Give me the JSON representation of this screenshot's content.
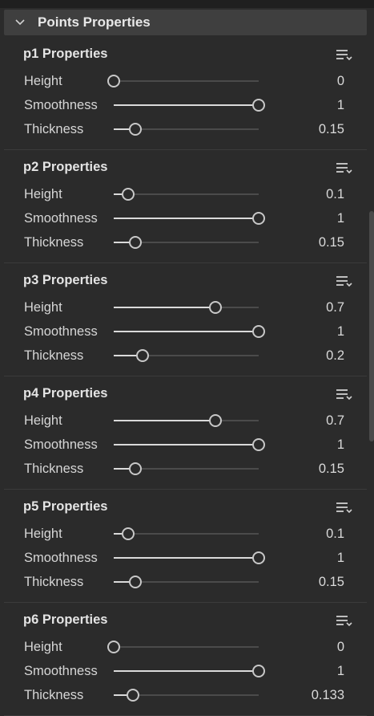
{
  "header": {
    "title": "Points Properties"
  },
  "panels": [
    {
      "title": "p1 Properties",
      "rows": [
        {
          "label": "Height",
          "value": "0",
          "level": 0
        },
        {
          "label": "Smoothness",
          "value": "1",
          "level": 1
        },
        {
          "label": "Thickness",
          "value": "0.15",
          "level": 0.15
        }
      ]
    },
    {
      "title": "p2 Properties",
      "rows": [
        {
          "label": "Height",
          "value": "0.1",
          "level": 0.1
        },
        {
          "label": "Smoothness",
          "value": "1",
          "level": 1
        },
        {
          "label": "Thickness",
          "value": "0.15",
          "level": 0.15
        }
      ]
    },
    {
      "title": "p3 Properties",
      "rows": [
        {
          "label": "Height",
          "value": "0.7",
          "level": 0.7
        },
        {
          "label": "Smoothness",
          "value": "1",
          "level": 1
        },
        {
          "label": "Thickness",
          "value": "0.2",
          "level": 0.2
        }
      ]
    },
    {
      "title": "p4 Properties",
      "rows": [
        {
          "label": "Height",
          "value": "0.7",
          "level": 0.7
        },
        {
          "label": "Smoothness",
          "value": "1",
          "level": 1
        },
        {
          "label": "Thickness",
          "value": "0.15",
          "level": 0.15
        }
      ]
    },
    {
      "title": "p5 Properties",
      "rows": [
        {
          "label": "Height",
          "value": "0.1",
          "level": 0.1
        },
        {
          "label": "Smoothness",
          "value": "1",
          "level": 1
        },
        {
          "label": "Thickness",
          "value": "0.15",
          "level": 0.15
        }
      ]
    },
    {
      "title": "p6 Properties",
      "rows": [
        {
          "label": "Height",
          "value": "0",
          "level": 0
        },
        {
          "label": "Smoothness",
          "value": "1",
          "level": 1
        },
        {
          "label": "Thickness",
          "value": "0.133",
          "level": 0.133
        }
      ]
    }
  ],
  "icons": {
    "collapse": "chevron-down-icon",
    "panel_menu": "list-options-icon"
  },
  "colors": {
    "background": "#2b2b2b",
    "header": "#3f3f3f",
    "slider_fill": "#dadada",
    "slider_track": "#4b4b4b"
  }
}
